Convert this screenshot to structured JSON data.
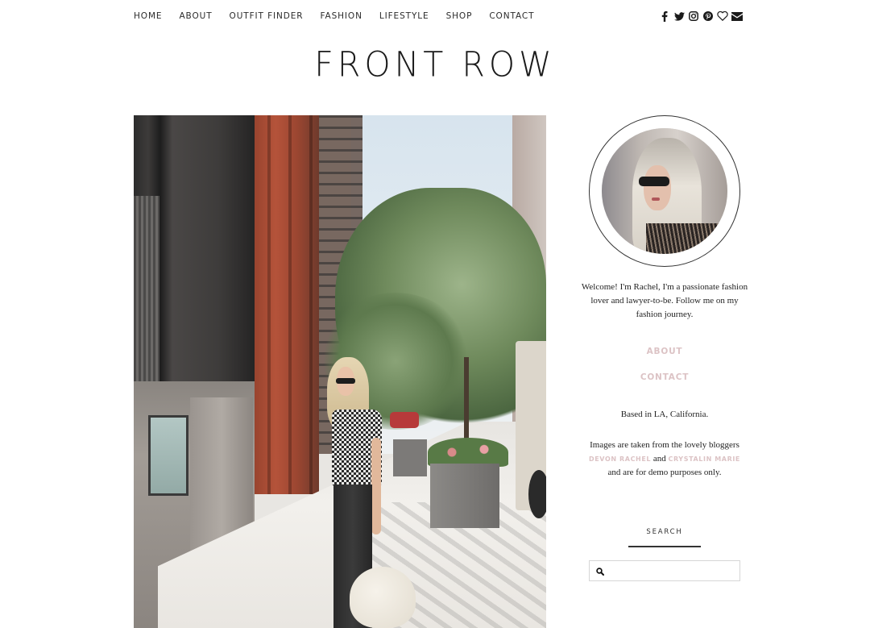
{
  "nav": {
    "items": [
      {
        "label": "HOME"
      },
      {
        "label": "ABOUT"
      },
      {
        "label": "OUTFIT FINDER"
      },
      {
        "label": "FASHION"
      },
      {
        "label": "LIFESTYLE"
      },
      {
        "label": "SHOP"
      },
      {
        "label": "CONTACT"
      }
    ],
    "social": [
      "facebook-icon",
      "twitter-icon",
      "instagram-icon",
      "pinterest-icon",
      "heart-icon",
      "envelope-icon"
    ]
  },
  "site": {
    "title": "FRONT ROW"
  },
  "hero": {
    "alt": "Blonde woman in gingham top and black jeans holding a white straw bag on a sunny city sidewalk"
  },
  "sidebar": {
    "profile_alt": "Portrait of Rachel with sunglasses and long blonde hair",
    "bio": "Welcome! I'm Rachel, I'm a passionate fashion lover and lawyer-to-be. Follow me on my fashion journey.",
    "links": [
      {
        "label": "ABOUT"
      },
      {
        "label": "CONTACT"
      }
    ],
    "location": "Based in LA, California.",
    "credits": {
      "prefix": "Images are taken from the lovely bloggers",
      "blogger1": "DEVON RACHEL",
      "joiner": "and",
      "blogger2": "CRYSTALIN MARIE",
      "suffix": "and are for demo purposes only."
    },
    "search": {
      "title": "SEARCH",
      "placeholder": "",
      "value": ""
    }
  },
  "colors": {
    "accent_pink": "#dcc3c5",
    "text": "#222222"
  }
}
